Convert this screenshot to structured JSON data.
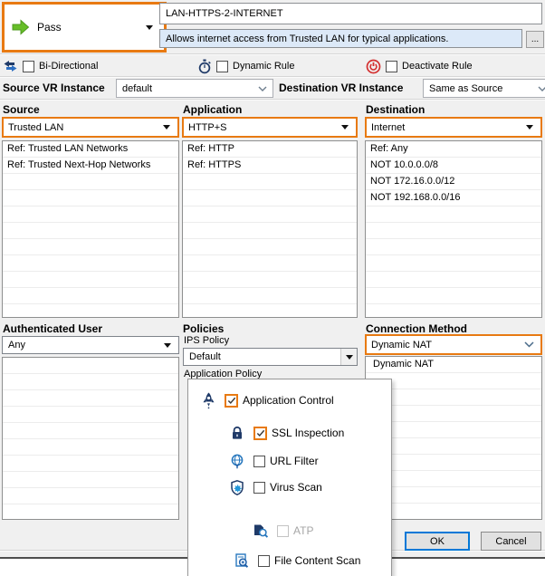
{
  "rule": {
    "action": "Pass",
    "name": "LAN-HTTPS-2-INTERNET",
    "description": "Allows internet access from Trusted LAN for typical applications.",
    "ellipsis": "..."
  },
  "flags": [
    {
      "label": "Bi-Directional",
      "icon": "bidirectional-icon",
      "checked": false
    },
    {
      "label": "Dynamic Rule",
      "icon": "stopwatch-icon",
      "checked": false
    },
    {
      "label": "Deactivate Rule",
      "icon": "power-icon",
      "checked": false
    }
  ],
  "vr": {
    "source_label": "Source VR Instance",
    "source_value": "default",
    "dest_label": "Destination VR Instance",
    "dest_value": "Same as Source"
  },
  "columns": {
    "source": {
      "header": "Source",
      "value": "Trusted LAN",
      "items": [
        "Ref: Trusted LAN Networks",
        "Ref: Trusted Next-Hop Networks"
      ]
    },
    "application": {
      "header": "Application",
      "value": "HTTP+S",
      "items": [
        "Ref: HTTP",
        "Ref: HTTPS"
      ]
    },
    "destination": {
      "header": "Destination",
      "value": "Internet",
      "items": [
        "Ref: Any",
        "NOT 10.0.0.0/8",
        "NOT 172.16.0.0/12",
        "NOT 192.168.0.0/16"
      ]
    }
  },
  "auth_user": {
    "header": "Authenticated User",
    "value": "Any"
  },
  "policies": {
    "header": "Policies",
    "ips_label": "IPS Policy",
    "ips_value": "Default",
    "app_policy_label": "Application Policy"
  },
  "connection": {
    "header": "Connection Method",
    "value": "Dynamic NAT",
    "items": [
      "Dynamic NAT"
    ]
  },
  "app_policy_menu": {
    "items": [
      {
        "label": "Application Control",
        "icon": "rocket-icon",
        "checked": true,
        "enabled": true
      },
      {
        "label": "SSL Inspection",
        "icon": "lock-icon",
        "checked": true,
        "enabled": true
      },
      {
        "label": "URL Filter",
        "icon": "globe-filter-icon",
        "checked": false,
        "enabled": true
      },
      {
        "label": "Virus Scan",
        "icon": "shield-virus-icon",
        "checked": false,
        "enabled": true
      },
      {
        "label": "ATP",
        "icon": "file-magnifier-icon",
        "checked": false,
        "enabled": false
      },
      {
        "label": "File Content Scan",
        "icon": "doc-search-icon",
        "checked": false,
        "enabled": true
      }
    ]
  },
  "buttons": {
    "ok": "OK",
    "cancel": "Cancel"
  },
  "colors": {
    "accent_orange": "#E87A12",
    "pass_green": "#67BE28",
    "icon_navy": "#1F3A68",
    "icon_blue": "#2878BE",
    "power_red": "#D32F2F",
    "focus_blue": "#0078D7",
    "description_bg": "#DCE9F8"
  }
}
